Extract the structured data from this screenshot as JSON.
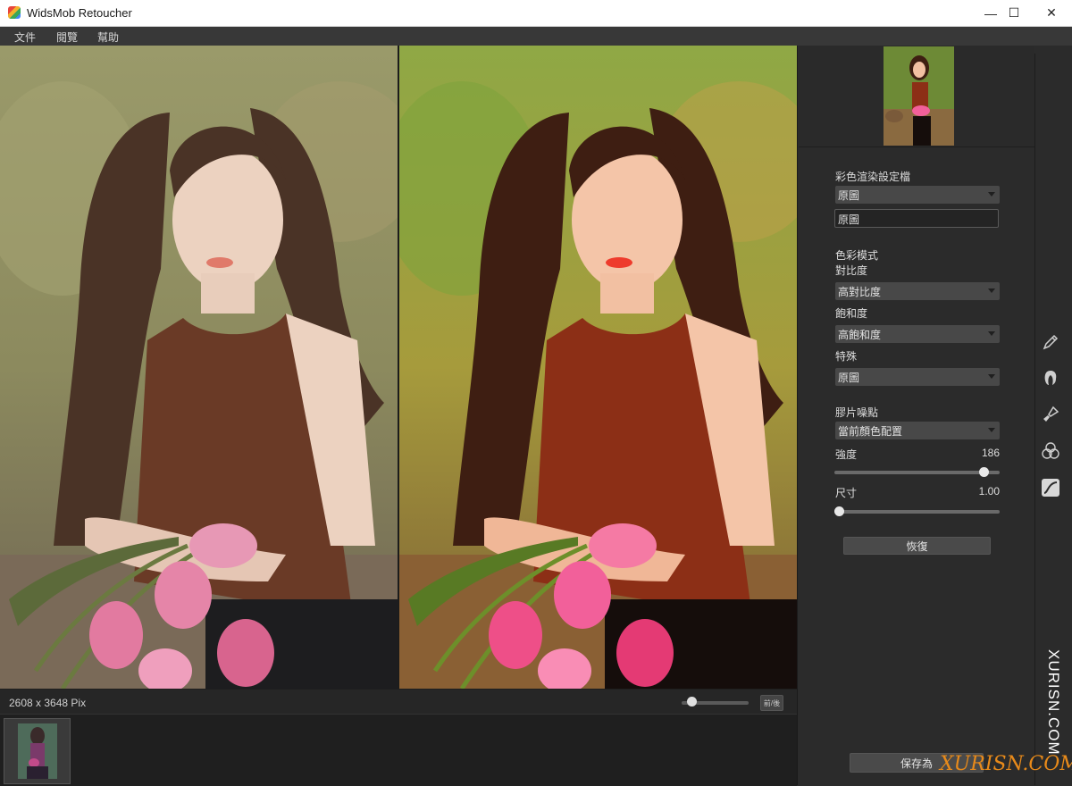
{
  "window": {
    "title": "WidsMob Retoucher",
    "minimize": "—",
    "maximize": "☐",
    "close": "✕"
  },
  "menu": [
    {
      "label": "文件"
    },
    {
      "label": "閱覽"
    },
    {
      "label": "幫助"
    }
  ],
  "status": {
    "dimensions": "2608 x 3648 Pix",
    "before_after_button": "前/後",
    "zoom_level": 0.1
  },
  "panel": {
    "color_profile": {
      "label": "彩色渲染設定檔",
      "selected": "原圖",
      "name_value": "原圖"
    },
    "color_mode": {
      "label": "色彩模式",
      "contrast": {
        "label": "對比度",
        "selected": "高對比度"
      },
      "saturation": {
        "label": "飽和度",
        "selected": "高飽和度"
      },
      "special": {
        "label": "特殊",
        "selected": "原圖"
      }
    },
    "film_grain": {
      "label": "膠片噪點",
      "preset": "當前顏色配置",
      "strength": {
        "label": "強度",
        "value": "186",
        "fraction": 0.93
      },
      "size": {
        "label": "尺寸",
        "value": "1.00",
        "fraction": 0.0
      }
    },
    "reset_button": "恢復",
    "save_button": "保存為"
  },
  "tools": [
    "pencil-icon",
    "hair-icon",
    "brush-icon",
    "color-circles-icon",
    "curve-icon"
  ],
  "watermarks": {
    "vertical": "XURISN.COM",
    "horizontal": "XURISN.COM"
  },
  "colors": {
    "background": "#2b2b2b",
    "menubar": "#383838",
    "accent": "#e88a1a"
  }
}
